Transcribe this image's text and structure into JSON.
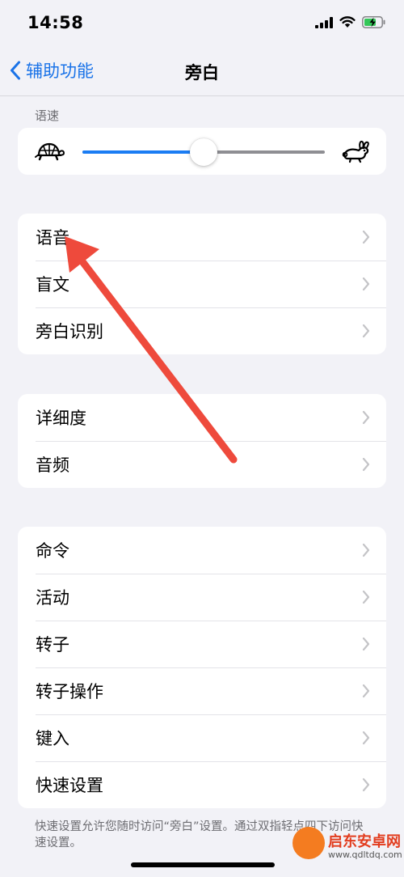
{
  "status_bar": {
    "time": "14:58"
  },
  "nav": {
    "back_label": "辅助功能",
    "title": "旁白"
  },
  "speech_rate": {
    "header": "语速",
    "value": 0.5
  },
  "groups": [
    {
      "items": [
        {
          "label": "语音"
        },
        {
          "label": "盲文"
        },
        {
          "label": "旁白识别"
        }
      ]
    },
    {
      "items": [
        {
          "label": "详细度"
        },
        {
          "label": "音频"
        }
      ]
    },
    {
      "items": [
        {
          "label": "命令"
        },
        {
          "label": "活动"
        },
        {
          "label": "转子"
        },
        {
          "label": "转子操作"
        },
        {
          "label": "键入"
        },
        {
          "label": "快速设置"
        }
      ]
    }
  ],
  "footer": "快速设置允许您随时访问“旁白”设置。通过双指轻点四下访问快速设置。",
  "watermark": {
    "title": "启东安卓网",
    "url": "www.qdltdq.com"
  },
  "colors": {
    "accent": "#1a7cf3",
    "annotation": "#ee4a3c"
  }
}
